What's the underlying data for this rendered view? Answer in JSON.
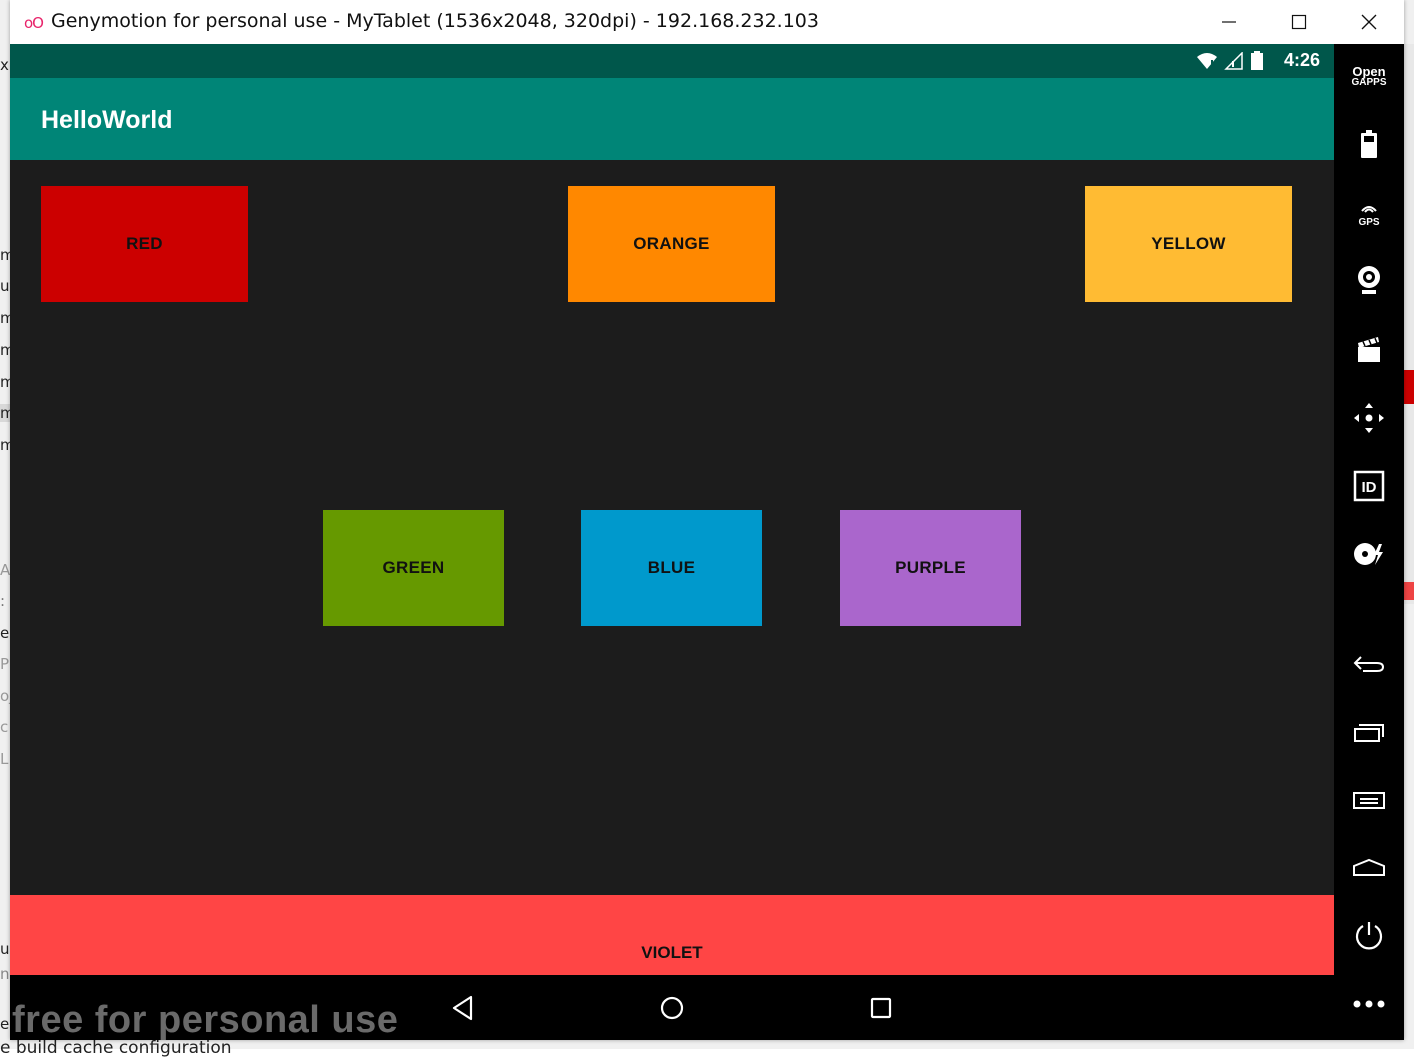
{
  "window": {
    "title": "Genymotion for personal use - MyTablet (1536x2048, 320dpi) - 192.168.232.103",
    "logo": "oO",
    "controls": [
      "minimize-icon",
      "maximize-icon",
      "close-icon"
    ]
  },
  "background_ide": {
    "fragments": [
      "xr",
      "m",
      "ut",
      "m",
      "m",
      "m",
      "m",
      "m",
      "A",
      ":",
      "e",
      "Pr",
      "oj",
      "c",
      "L",
      "u",
      "n",
      "e"
    ],
    "bottom_text": "e build cache configuration"
  },
  "device": {
    "status_bar": {
      "time": "4:26",
      "icons": [
        "wifi-icon",
        "signal-icon",
        "battery-icon"
      ]
    },
    "app_bar": {
      "title": "HelloWorld"
    },
    "buttons": [
      {
        "label": "RED",
        "color": "#cc0000"
      },
      {
        "label": "ORANGE",
        "color": "#ff8800"
      },
      {
        "label": "YELLOW",
        "color": "#ffbb33"
      },
      {
        "label": "GREEN",
        "color": "#669900"
      },
      {
        "label": "BLUE",
        "color": "#0099cc"
      },
      {
        "label": "PURPLE",
        "color": "#aa66cc"
      }
    ],
    "bottom_button": {
      "label": "VIOLET",
      "color": "#ff4545"
    },
    "nav_bar": [
      "back-icon",
      "home-icon",
      "recents-icon"
    ],
    "watermark": "free for personal use"
  },
  "side_panel": {
    "opengapps": {
      "line1": "Open",
      "line2": "GAPPS"
    },
    "items": [
      "battery-icon",
      "gps-icon",
      "webcam-icon",
      "capture-icon",
      "remote-control-icon",
      "identifiers-icon",
      "disk-io-icon",
      "back-icon",
      "recents-icon",
      "menu-icon",
      "home-icon",
      "power-icon",
      "more-icon"
    ],
    "gps_label": "GPS",
    "id_label": "ID"
  },
  "colors": {
    "status_bar": "#00574b",
    "app_bar": "#008577",
    "content_bg": "#1c1c1c"
  }
}
